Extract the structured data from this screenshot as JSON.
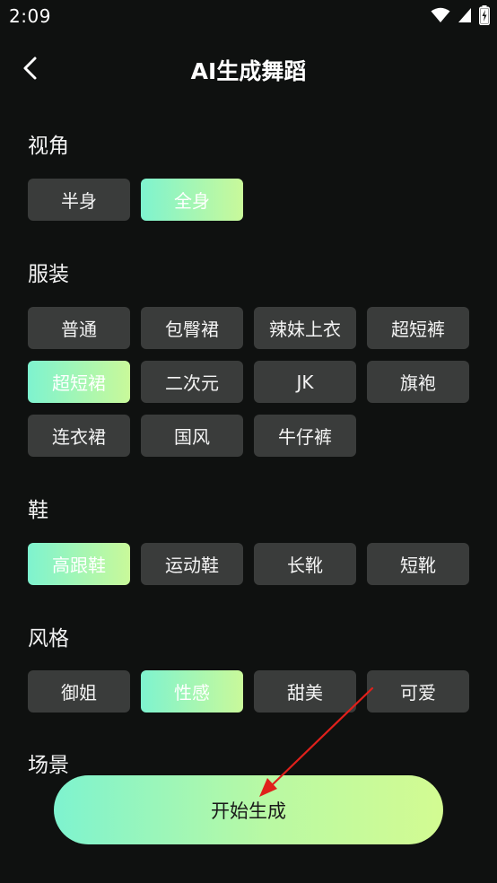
{
  "status": {
    "time": "2:09"
  },
  "header": {
    "title": "AI生成舞蹈"
  },
  "sections": [
    {
      "id": "view",
      "title": "视角",
      "options": [
        {
          "label": "半身",
          "selected": false
        },
        {
          "label": "全身",
          "selected": true
        }
      ]
    },
    {
      "id": "outfit",
      "title": "服装",
      "options": [
        {
          "label": "普通",
          "selected": false
        },
        {
          "label": "包臀裙",
          "selected": false
        },
        {
          "label": "辣妹上衣",
          "selected": false
        },
        {
          "label": "超短裤",
          "selected": false
        },
        {
          "label": "超短裙",
          "selected": true
        },
        {
          "label": "二次元",
          "selected": false
        },
        {
          "label": "JK",
          "selected": false
        },
        {
          "label": "旗袍",
          "selected": false
        },
        {
          "label": "连衣裙",
          "selected": false
        },
        {
          "label": "国风",
          "selected": false
        },
        {
          "label": "牛仔裤",
          "selected": false
        }
      ]
    },
    {
      "id": "shoes",
      "title": "鞋",
      "options": [
        {
          "label": "高跟鞋",
          "selected": true
        },
        {
          "label": "运动鞋",
          "selected": false
        },
        {
          "label": "长靴",
          "selected": false
        },
        {
          "label": "短靴",
          "selected": false
        }
      ]
    },
    {
      "id": "style",
      "title": "风格",
      "options": [
        {
          "label": "御姐",
          "selected": false
        },
        {
          "label": "性感",
          "selected": true
        },
        {
          "label": "甜美",
          "selected": false
        },
        {
          "label": "可爱",
          "selected": false
        }
      ]
    },
    {
      "id": "scene",
      "title": "场景",
      "options": []
    }
  ],
  "cta": {
    "label": "开始生成"
  },
  "colors": {
    "background": "#0f1110",
    "chip": "#3a3c3b",
    "gradient_start": "#7ef3cf",
    "gradient_end": "#c9f99a",
    "annotation_arrow": "#e0201b"
  },
  "icons": {
    "back": "chevron-left-icon",
    "wifi": "wifi-icon",
    "signal": "signal-icon",
    "battery": "battery-charging-icon"
  }
}
